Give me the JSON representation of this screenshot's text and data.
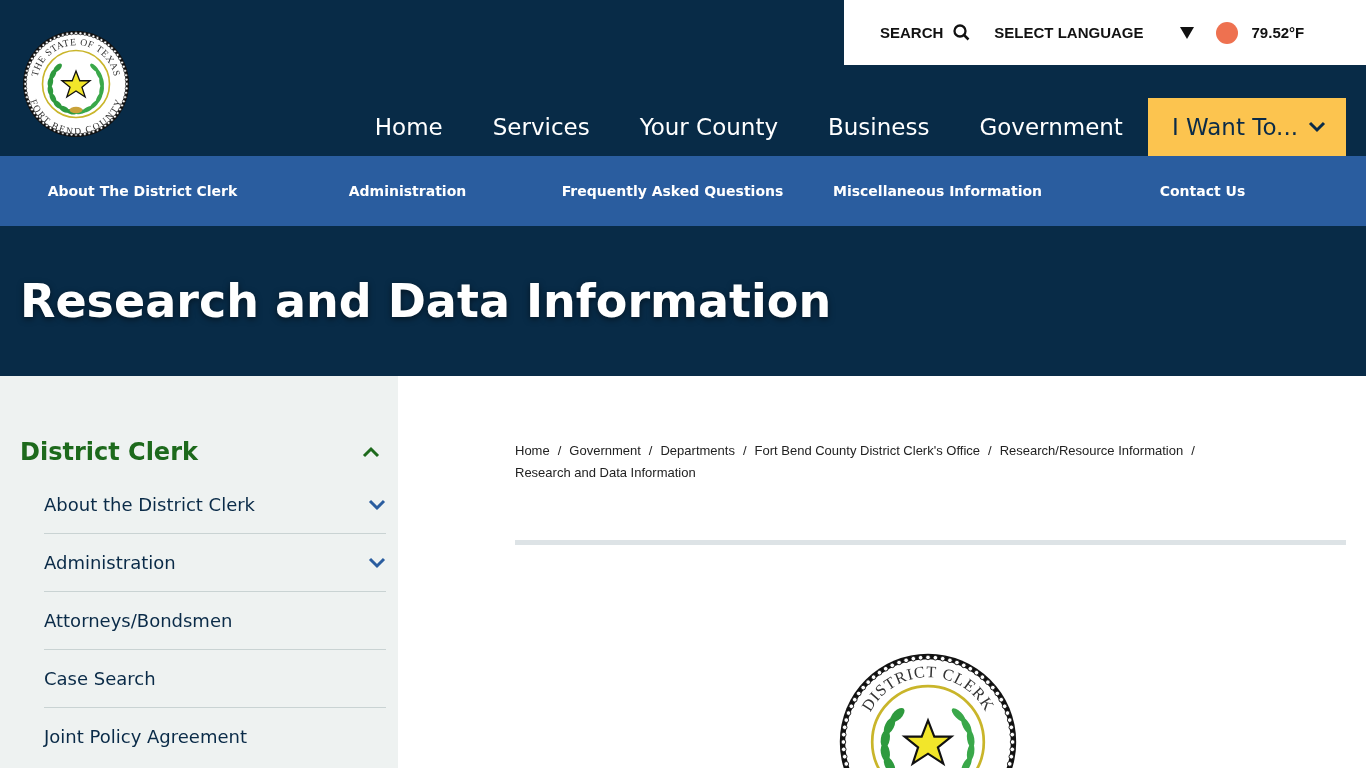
{
  "header": {
    "logo": {
      "top_text": "THE STATE OF TEXAS",
      "bottom_text": "FORT BEND COUNTY"
    },
    "utility": {
      "search": "SEARCH",
      "language": "SELECT LANGUAGE",
      "temperature": "79.52°F"
    },
    "nav": [
      {
        "label": "Home",
        "kind": "link"
      },
      {
        "label": "Services",
        "kind": "link"
      },
      {
        "label": "Your County",
        "kind": "link"
      },
      {
        "label": "Business",
        "kind": "link"
      },
      {
        "label": "Government",
        "kind": "link"
      },
      {
        "label": "I Want To...",
        "kind": "menu"
      }
    ]
  },
  "subnav": [
    "About The District Clerk",
    "Administration",
    "Frequently Asked Questions",
    "Miscellaneous Information",
    "Contact Us"
  ],
  "page_title": "Research and Data Information",
  "sidebar": {
    "title": "District Clerk",
    "expanded": true,
    "items": [
      {
        "label": "About the District Clerk",
        "kind": "group"
      },
      {
        "label": "Administration",
        "kind": "group"
      },
      {
        "label": "Attorneys/Bondsmen",
        "kind": "link"
      },
      {
        "label": "Case Search",
        "kind": "link"
      },
      {
        "label": "Joint Policy Agreement",
        "kind": "link"
      }
    ]
  },
  "breadcrumb": {
    "separator": "/",
    "items": [
      "Home",
      "Government",
      "Departments",
      "Fort Bend County District Clerk's Office",
      "Research/Resource Information",
      "Research and Data Information"
    ]
  },
  "content_seal": {
    "top_text": "DISTRICT CLERK"
  }
}
